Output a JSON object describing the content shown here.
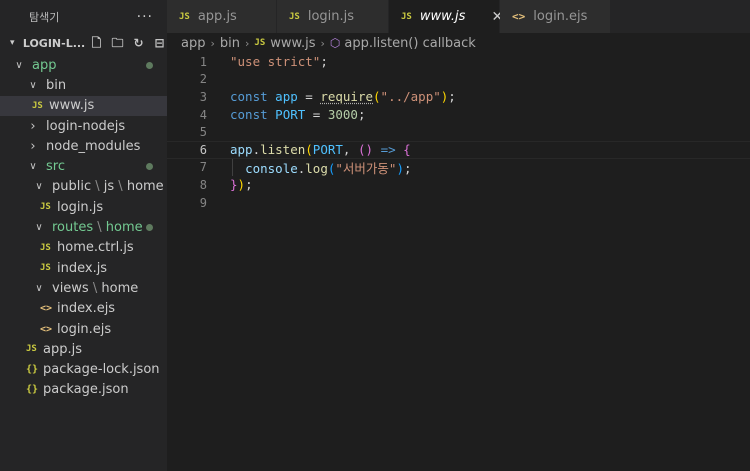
{
  "sidebar": {
    "title": "탐색기",
    "more_glyph": "···",
    "root_label": "LOGIN-L...",
    "tree": [
      {
        "label": "app",
        "indent": 1,
        "chevron": "down",
        "icon": "",
        "color": "green",
        "dot": true
      },
      {
        "label": "bin",
        "indent": 2,
        "chevron": "down",
        "icon": "",
        "color": "normal",
        "dot": false
      },
      {
        "label": "www.js",
        "indent": 3,
        "chevron": "",
        "icon": "JS",
        "color": "normal",
        "dot": false,
        "selected": true
      },
      {
        "label": "login-nodejs",
        "indent": 2,
        "chevron": "right",
        "icon": "",
        "color": "normal",
        "dot": false
      },
      {
        "label": "node_modules",
        "indent": 2,
        "chevron": "right",
        "icon": "",
        "color": "normal",
        "dot": false
      },
      {
        "label": "src",
        "indent": 2,
        "chevron": "down",
        "icon": "",
        "color": "green",
        "dot": true
      },
      {
        "label": "public",
        "sub": [
          "js",
          "home"
        ],
        "indent": 3,
        "chevron": "down",
        "icon": "",
        "color": "normal",
        "dot": false
      },
      {
        "label": "login.js",
        "indent": 4,
        "chevron": "",
        "icon": "JS",
        "color": "normal",
        "dot": false
      },
      {
        "label": "routes",
        "sub": [
          "home"
        ],
        "indent": 3,
        "chevron": "down",
        "icon": "",
        "color": "green",
        "dot": true
      },
      {
        "label": "home.ctrl.js",
        "indent": 4,
        "chevron": "",
        "icon": "JS",
        "color": "normal",
        "dot": false
      },
      {
        "label": "index.js",
        "indent": 4,
        "chevron": "",
        "icon": "JS",
        "color": "normal",
        "dot": false
      },
      {
        "label": "views",
        "sub": [
          "home"
        ],
        "indent": 3,
        "chevron": "down",
        "icon": "",
        "color": "normal",
        "dot": false
      },
      {
        "label": "index.ejs",
        "indent": 4,
        "chevron": "",
        "icon": "<>",
        "color": "normal",
        "dot": false
      },
      {
        "label": "login.ejs",
        "indent": 4,
        "chevron": "",
        "icon": "<>",
        "color": "normal",
        "dot": false
      },
      {
        "label": "app.js",
        "indent": 2,
        "chevron": "",
        "icon": "JS",
        "color": "normal",
        "dot": false
      },
      {
        "label": "package-lock.json",
        "indent": 2,
        "chevron": "",
        "icon": "{}",
        "color": "normal",
        "dot": false
      },
      {
        "label": "package.json",
        "indent": 2,
        "chevron": "",
        "icon": "{}",
        "color": "normal",
        "dot": false
      }
    ]
  },
  "tabs": [
    {
      "label": "app.js",
      "icon": "JS",
      "active": false
    },
    {
      "label": "login.js",
      "icon": "JS",
      "active": false
    },
    {
      "label": "www.js",
      "icon": "JS",
      "active": true
    },
    {
      "label": "login.ejs",
      "icon": "<>",
      "active": false
    }
  ],
  "breadcrumb": {
    "parts": [
      "app",
      "bin",
      "www.js",
      "app.listen() callback"
    ],
    "file_icon": "JS"
  },
  "editor": {
    "current_line": 6,
    "lines": [
      {
        "n": "1",
        "tokens": [
          [
            "str",
            "\"use strict\""
          ],
          [
            "plain",
            ";"
          ]
        ]
      },
      {
        "n": "2",
        "tokens": []
      },
      {
        "n": "3",
        "tokens": [
          [
            "kw",
            "const"
          ],
          [
            "plain",
            " "
          ],
          [
            "var",
            "app"
          ],
          [
            "plain",
            " = "
          ],
          [
            "fnsq",
            "require"
          ],
          [
            "p1",
            "("
          ],
          [
            "str",
            "\"../app\""
          ],
          [
            "p1",
            ")"
          ],
          [
            "plain",
            ";"
          ]
        ]
      },
      {
        "n": "4",
        "tokens": [
          [
            "kw",
            "const"
          ],
          [
            "plain",
            " "
          ],
          [
            "var",
            "PORT"
          ],
          [
            "plain",
            " = "
          ],
          [
            "num",
            "3000"
          ],
          [
            "plain",
            ";"
          ]
        ]
      },
      {
        "n": "5",
        "tokens": []
      },
      {
        "n": "6",
        "tokens": [
          [
            "id",
            "app"
          ],
          [
            "plain",
            "."
          ],
          [
            "fn",
            "listen"
          ],
          [
            "p1",
            "("
          ],
          [
            "var",
            "PORT"
          ],
          [
            "plain",
            ", "
          ],
          [
            "p2",
            "()"
          ],
          [
            "plain",
            " "
          ],
          [
            "kw",
            "=>"
          ],
          [
            "plain",
            " "
          ],
          [
            "p2",
            "{"
          ]
        ]
      },
      {
        "n": "7",
        "tokens": [
          [
            "plain",
            "  "
          ],
          [
            "id",
            "console"
          ],
          [
            "plain",
            "."
          ],
          [
            "fn",
            "log"
          ],
          [
            "p3",
            "("
          ],
          [
            "str",
            "\"서버가동\""
          ],
          [
            "p3",
            ")"
          ],
          [
            "plain",
            ";"
          ]
        ]
      },
      {
        "n": "8",
        "tokens": [
          [
            "p2",
            "}"
          ],
          [
            "p1",
            ")"
          ],
          [
            "plain",
            ";"
          ]
        ]
      },
      {
        "n": "9",
        "tokens": []
      }
    ]
  }
}
